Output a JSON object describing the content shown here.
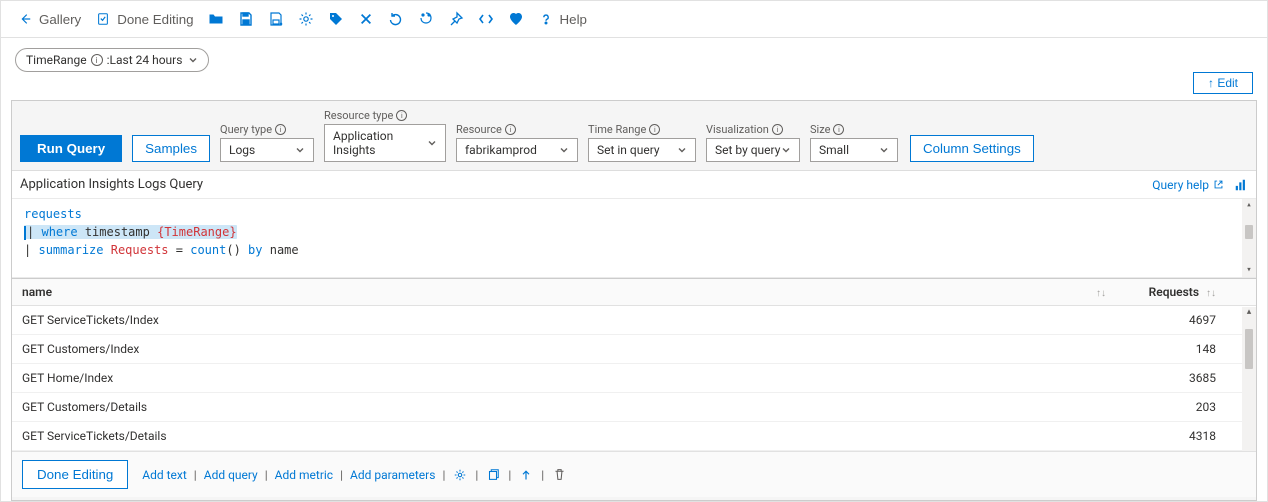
{
  "top_toolbar": {
    "gallery": "Gallery",
    "done_editing": "Done Editing",
    "help": "Help"
  },
  "parameters": {
    "time_range_key": "TimeRange",
    "time_range_value": "Last 24 hours"
  },
  "edit_button": "↑ Edit",
  "query_toolbar": {
    "run_query": "Run Query",
    "samples": "Samples",
    "fields": {
      "query_type": {
        "label": "Query type",
        "value": "Logs"
      },
      "resource_type": {
        "label": "Resource type",
        "value": "Application Insights"
      },
      "resource": {
        "label": "Resource",
        "value": "fabrikamprod"
      },
      "time_range": {
        "label": "Time Range",
        "value": "Set in query"
      },
      "visualization": {
        "label": "Visualization",
        "value": "Set by query"
      },
      "size": {
        "label": "Size",
        "value": "Small"
      }
    },
    "column_settings": "Column Settings"
  },
  "query_title": "Application Insights Logs Query",
  "query_help": "Query help",
  "editor": {
    "line1_table": "requests",
    "line2_pipe": "|",
    "line2_where": "where",
    "line2_col": "timestamp",
    "line2_param": "{TimeRange}",
    "line3_pipe": "|",
    "line3_summarize": "summarize",
    "line3_alias": "Requests",
    "line3_eq": "=",
    "line3_fn": "count",
    "line3_par": "()",
    "line3_by": "by",
    "line3_col": "name"
  },
  "table": {
    "cols": {
      "name": "name",
      "requests": "Requests"
    },
    "rows": [
      {
        "name": "GET ServiceTickets/Index",
        "requests": "4697"
      },
      {
        "name": "GET Customers/Index",
        "requests": "148"
      },
      {
        "name": "GET Home/Index",
        "requests": "3685"
      },
      {
        "name": "GET Customers/Details",
        "requests": "203"
      },
      {
        "name": "GET ServiceTickets/Details",
        "requests": "4318"
      }
    ]
  },
  "footer": {
    "done_editing": "Done Editing",
    "add_text": "Add text",
    "add_query": "Add query",
    "add_metric": "Add metric",
    "add_parameters": "Add parameters"
  }
}
